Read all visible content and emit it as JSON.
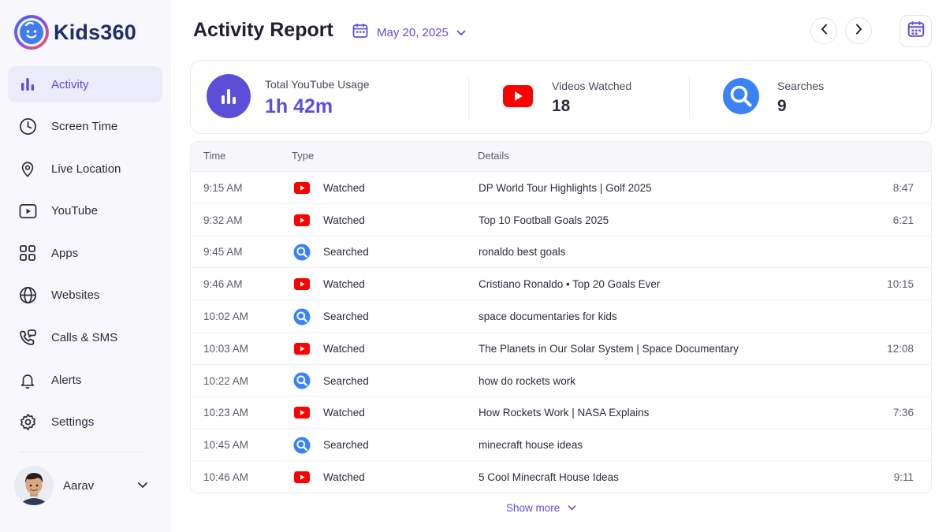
{
  "app": {
    "name": "Kids360"
  },
  "sidebar": {
    "items": [
      {
        "label": "Activity",
        "icon": "bar-chart-icon",
        "active": true
      },
      {
        "label": "Screen Time",
        "icon": "clock-icon"
      },
      {
        "label": "Live Location",
        "icon": "location-pin-icon"
      },
      {
        "label": "YouTube",
        "icon": "play-icon"
      },
      {
        "label": "Apps",
        "icon": "apps-grid-icon"
      },
      {
        "label": "Websites",
        "icon": "globe-icon"
      },
      {
        "label": "Calls & SMS",
        "icon": "phone-message-icon"
      },
      {
        "label": "Alerts",
        "icon": "bell-icon"
      },
      {
        "label": "Settings",
        "icon": "gear-icon"
      }
    ],
    "profile": {
      "name": "Aarav"
    }
  },
  "header": {
    "title": "Activity Report",
    "date": "May 20, 2025"
  },
  "summary": {
    "usage": {
      "label": "Total YouTube Usage",
      "value": "1h 42m"
    },
    "videos": {
      "label": "Videos Watched",
      "value": "18"
    },
    "searches": {
      "label": "Searches",
      "value": "9"
    }
  },
  "table": {
    "columns": {
      "time": "Time",
      "type": "Type",
      "details": "Details"
    },
    "rows": [
      {
        "time": "9:15 AM",
        "type": "Watched",
        "kind": "watch",
        "details": "DP World Tour Highlights | Golf 2025",
        "duration": "8:47"
      },
      {
        "time": "9:32 AM",
        "type": "Watched",
        "kind": "watch",
        "details": "Top 10 Football Goals 2025",
        "duration": "6:21"
      },
      {
        "time": "9:45 AM",
        "type": "Searched",
        "kind": "search",
        "details": "ronaldo best goals",
        "duration": ""
      },
      {
        "time": "9:46 AM",
        "type": "Watched",
        "kind": "watch",
        "details": "Cristiano Ronaldo • Top 20 Goals Ever",
        "duration": "10:15"
      },
      {
        "time": "10:02 AM",
        "type": "Searched",
        "kind": "search",
        "details": "space documentaries for kids",
        "duration": ""
      },
      {
        "time": "10:03 AM",
        "type": "Watched",
        "kind": "watch",
        "details": "The Planets in Our Solar System | Space Documentary",
        "duration": "12:08"
      },
      {
        "time": "10:22 AM",
        "type": "Searched",
        "kind": "search",
        "details": "how do rockets work",
        "duration": ""
      },
      {
        "time": "10:23 AM",
        "type": "Watched",
        "kind": "watch",
        "details": "How Rockets Work | NASA Explains",
        "duration": "7:36"
      },
      {
        "time": "10:45 AM",
        "type": "Searched",
        "kind": "search",
        "details": "minecraft house ideas",
        "duration": ""
      },
      {
        "time": "10:46 AM",
        "type": "Watched",
        "kind": "watch",
        "details": "5 Cool Minecraft House Ideas",
        "duration": "9:11"
      }
    ],
    "show_more": "Show more"
  },
  "colors": {
    "accent": "#5b4fd8",
    "youtube_red": "#ff0000",
    "search_blue": "#3b82f6"
  }
}
